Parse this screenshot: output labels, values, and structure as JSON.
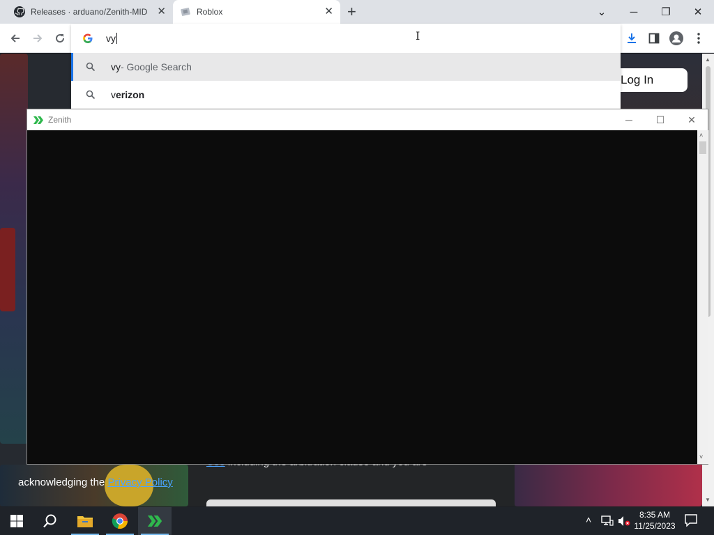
{
  "browser": {
    "tabs": [
      {
        "title": "Releases · arduano/Zenith-MIDI",
        "favicon": "github-icon",
        "active": false
      },
      {
        "title": "Roblox",
        "favicon": "roblox-icon",
        "active": true
      }
    ],
    "new_tab_symbol": "+",
    "window_controls": {
      "tab_search": "⌄",
      "minimize": "─",
      "restore": "❐",
      "close": "✕"
    },
    "omnibox": {
      "query": "vy",
      "suggestions": [
        {
          "text": "vy",
          "suffix": " - Google Search",
          "selected": true
        },
        {
          "prefix": "v",
          "text": "erizon",
          "selected": false
        }
      ]
    }
  },
  "roblox_page": {
    "login_button": "Log In",
    "legal_line1_link": "Use",
    "legal_line1_text": " including the arbitration clause and you are",
    "legal_line2_text": "acknowledging the ",
    "legal_line2_link": "Privacy Policy"
  },
  "zenith_window": {
    "title": "Zenith",
    "controls": {
      "minimize": "─",
      "maximize": "☐",
      "close": "✕"
    }
  },
  "taskbar": {
    "time": "8:35 AM",
    "date": "11/25/2023"
  },
  "colors": {
    "accent_blue": "#1a73e8",
    "zenith_green": "#2fb84d",
    "taskbar": "#1f2329"
  }
}
